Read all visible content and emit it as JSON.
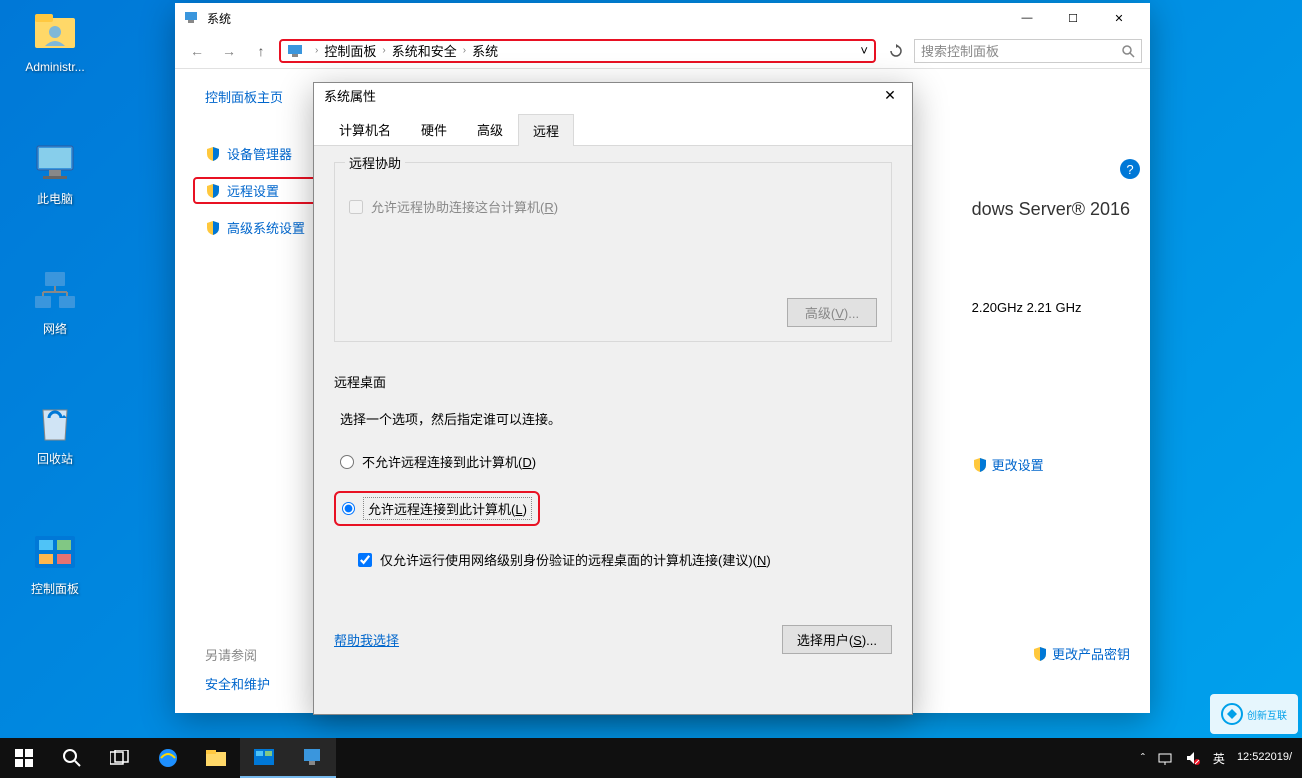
{
  "desktop": {
    "icons": [
      {
        "label": "Administr...",
        "type": "user"
      },
      {
        "label": "此电脑",
        "type": "pc"
      },
      {
        "label": "网络",
        "type": "network"
      },
      {
        "label": "回收站",
        "type": "recycle"
      },
      {
        "label": "控制面板",
        "type": "control"
      }
    ]
  },
  "window": {
    "title": "系统",
    "nav": {
      "back": "←",
      "forward": "→",
      "up": "↑"
    },
    "breadcrumb": [
      "控制面板",
      "系统和安全",
      "系统"
    ],
    "breadcrumb_dropdown": "˅",
    "refresh": "↻",
    "search_placeholder": "搜索控制面板",
    "ctrls": {
      "min": "—",
      "max": "☐",
      "close": "✕"
    },
    "help": "?",
    "sidebar": {
      "main": "控制面板主页",
      "items": [
        {
          "label": "设备管理器"
        },
        {
          "label": "远程设置",
          "highlighted": true
        },
        {
          "label": "高级系统设置"
        }
      ]
    },
    "see_also": {
      "heading": "另请参阅",
      "link": "安全和维护"
    },
    "content": {
      "os_line": "dows Server® 2016",
      "cpu_line": "2.20GHz  2.21 GHz",
      "change_settings": "更改设置",
      "change_key": "更改产品密钥"
    }
  },
  "dialog": {
    "title": "系统属性",
    "close": "✕",
    "tabs": [
      "计算机名",
      "硬件",
      "高级",
      "远程"
    ],
    "active_tab": 3,
    "remote_assist": {
      "legend": "远程协助",
      "checkbox": "允许远程协助连接这台计算机(",
      "checkbox_letter": "R",
      "advanced_btn": "高级(",
      "advanced_letter": "V",
      "advanced_suffix": ")..."
    },
    "remote_desktop": {
      "legend": "远程桌面",
      "instruction": "选择一个选项，然后指定谁可以连接。",
      "radio_deny": "不允许远程连接到此计算机(",
      "radio_deny_letter": "D",
      "radio_allow": "允许远程连接到此计算机(",
      "radio_allow_letter": "L",
      "nla_checkbox": "仅允许运行使用网络级别身份验证的远程桌面的计算机连接(建议)(",
      "nla_letter": "N",
      "help_link": "帮助我选择",
      "select_users": "选择用户(",
      "select_users_letter": "S",
      "select_users_suffix": ")..."
    }
  },
  "taskbar": {
    "tray": {
      "ime": "英",
      "time": "12:52",
      "date": "2019/"
    },
    "watermark": "创新互联"
  }
}
